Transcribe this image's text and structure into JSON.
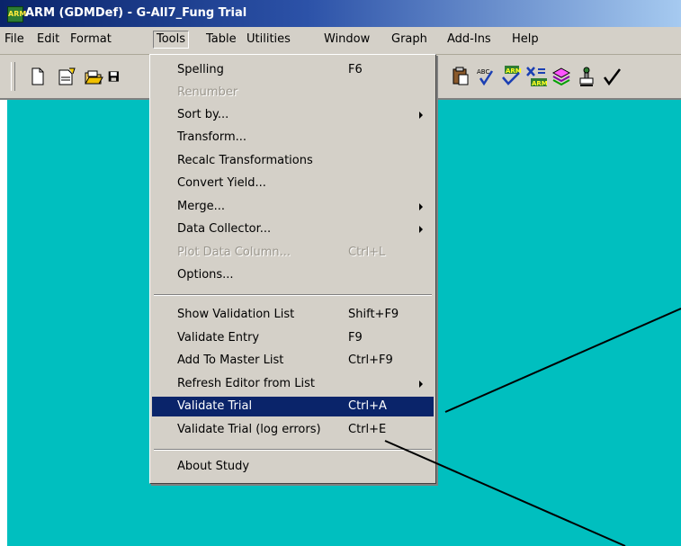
{
  "window": {
    "title": "ARM (GDMDef) - G-All7_Fung Trial",
    "icon": "arm-app-icon",
    "icon_text": "ARM"
  },
  "menubar": {
    "items": [
      {
        "label": "File"
      },
      {
        "label": "Edit"
      },
      {
        "label": "Format"
      },
      {
        "label": "Tools"
      },
      {
        "label": "Table"
      },
      {
        "label": "Utilities"
      },
      {
        "label": "Window"
      },
      {
        "label": "Graph"
      },
      {
        "label": "Add-Ins"
      },
      {
        "label": "Help"
      }
    ],
    "open_menu": "Tools"
  },
  "toolbar": {
    "icons": [
      "new-file-icon",
      "open-file-icon",
      "open-folder-icon",
      "save-icon",
      "paste-icon",
      "spelling-icon",
      "validate-icon",
      "excel-arm-icon",
      "books-icon",
      "stamp-icon",
      "checkmark-icon"
    ]
  },
  "tools_menu": {
    "items": [
      {
        "label": "Spelling",
        "shortcut": "F6"
      },
      {
        "label": "Renumber",
        "shortcut": "",
        "disabled": true
      },
      {
        "label": "Sort by...",
        "shortcut": "",
        "submenu": true
      },
      {
        "label": "Transform...",
        "shortcut": ""
      },
      {
        "label": "Recalc Transformations",
        "shortcut": ""
      },
      {
        "label": "Convert Yield...",
        "shortcut": ""
      },
      {
        "label": "Merge...",
        "shortcut": "",
        "submenu": true
      },
      {
        "label": "Data Collector...",
        "shortcut": "",
        "submenu": true
      },
      {
        "label": "Plot Data Column...",
        "shortcut": "Ctrl+L",
        "disabled": true
      },
      {
        "label": "Options...",
        "shortcut": ""
      },
      {
        "label": "Show Validation List",
        "shortcut": "Shift+F9"
      },
      {
        "label": "Validate Entry",
        "shortcut": "F9"
      },
      {
        "label": "Add To Master List",
        "shortcut": "Ctrl+F9"
      },
      {
        "label": "Refresh Editor from List",
        "shortcut": "",
        "submenu": true
      },
      {
        "label": "Validate Trial",
        "shortcut": "Ctrl+A",
        "highlighted": true
      },
      {
        "label": "Validate Trial (log errors)",
        "shortcut": "Ctrl+E"
      },
      {
        "label": "About Study",
        "shortcut": ""
      }
    ]
  },
  "colors": {
    "workspace": "#00bfbf",
    "menu_highlight": "#0a246a",
    "chrome": "#d4d0c8"
  }
}
